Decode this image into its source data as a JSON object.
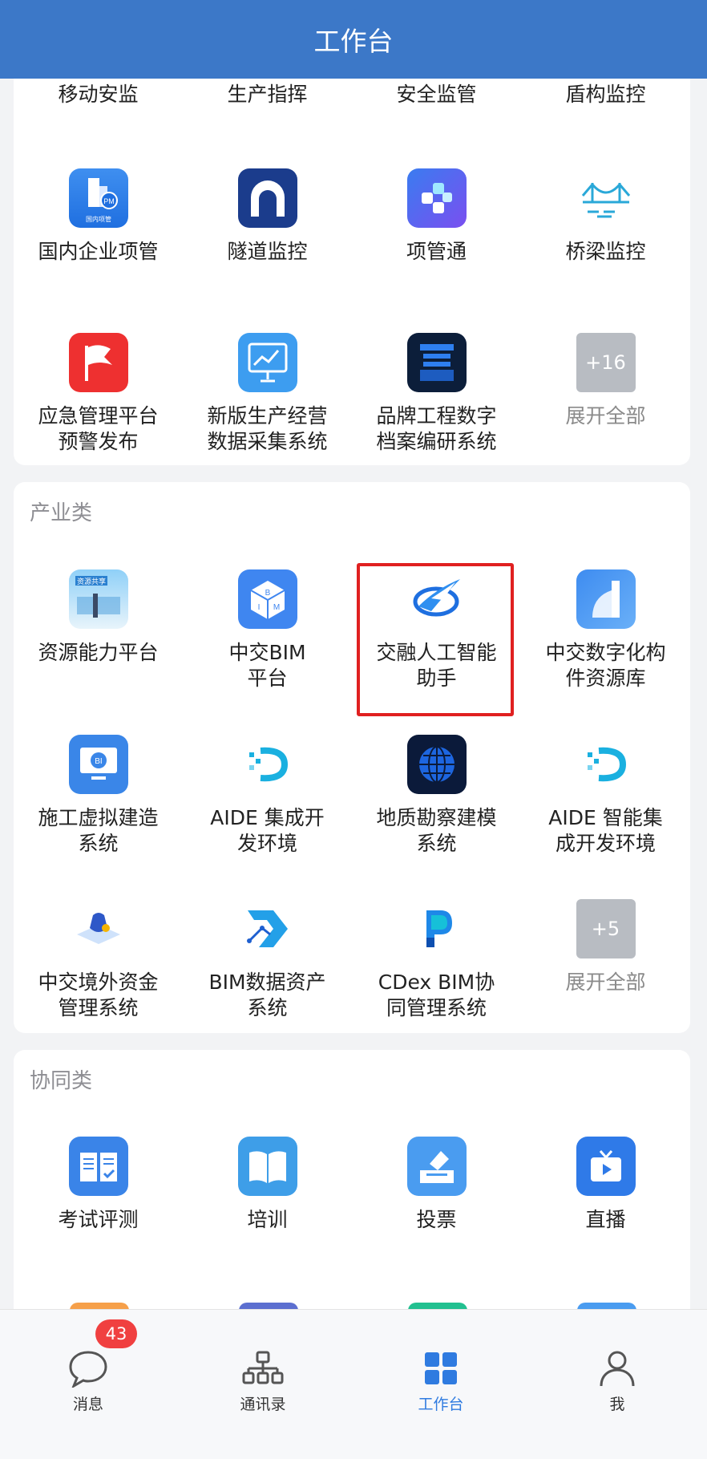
{
  "header": {
    "title": "工作台"
  },
  "card1": {
    "top_row": [
      "移动安监",
      "生产指挥",
      "安全监管",
      "盾构监控"
    ],
    "items": [
      {
        "label": "国内企业项管",
        "icon": "pm-building-icon",
        "sub": "国内项管"
      },
      {
        "label": "隧道监控",
        "icon": "tunnel-icon"
      },
      {
        "label": "项管通",
        "icon": "puzzle-icon"
      },
      {
        "label": "桥梁监控",
        "icon": "bridge-icon"
      },
      {
        "label": "应急管理平台\n预警发布",
        "icon": "flag-icon"
      },
      {
        "label": "新版生产经营\n数据采集系统",
        "icon": "chart-board-icon"
      },
      {
        "label": "品牌工程数字\n档案编研系统",
        "icon": "archive-icon"
      },
      {
        "label": "展开全部",
        "icon": "more-icon",
        "more": "+16"
      }
    ]
  },
  "card2": {
    "title": "产业类",
    "items": [
      {
        "label": "资源能力平台",
        "icon": "resource-share-icon",
        "sub": "资源共享"
      },
      {
        "label": "中交BIM\n平台",
        "icon": "bim-cube-icon"
      },
      {
        "label": "交融人工智能\n助手",
        "icon": "ai-wing-icon"
      },
      {
        "label": "中交数字化构\n件资源库",
        "icon": "digital-component-icon"
      },
      {
        "label": "施工虚拟建造\n系统",
        "icon": "monitor-icon"
      },
      {
        "label": "AIDE 集成开\n发环境",
        "icon": "aide-icon"
      },
      {
        "label": "地质勘察建模\n系统",
        "icon": "globe-icon"
      },
      {
        "label": "AIDE 智能集\n成开发环境",
        "icon": "aide-icon"
      },
      {
        "label": "中交境外资金\n管理系统",
        "icon": "money-bag-icon"
      },
      {
        "label": "BIM数据资产\n系统",
        "icon": "bim-data-icon"
      },
      {
        "label": "CDex BIM协\n同管理系统",
        "icon": "cdex-icon"
      },
      {
        "label": "展开全部",
        "icon": "more-icon",
        "more": "+5"
      }
    ]
  },
  "card3": {
    "title": "协同类",
    "items": [
      {
        "label": "考试评测",
        "icon": "exam-book-icon"
      },
      {
        "label": "培训",
        "icon": "open-book-icon"
      },
      {
        "label": "投票",
        "icon": "vote-icon"
      },
      {
        "label": "直播",
        "icon": "live-tv-icon"
      }
    ]
  },
  "tabbar": {
    "tabs": [
      {
        "label": "消息",
        "icon": "chat-bubble-icon",
        "badge": "43"
      },
      {
        "label": "通讯录",
        "icon": "org-chart-icon"
      },
      {
        "label": "工作台",
        "icon": "grid-icon"
      },
      {
        "label": "我",
        "icon": "person-icon"
      }
    ],
    "active_index": 2
  },
  "colors": {
    "header": "#3c78c8",
    "active": "#2f7be0",
    "badge": "#f04040",
    "highlight": "#e02020"
  }
}
